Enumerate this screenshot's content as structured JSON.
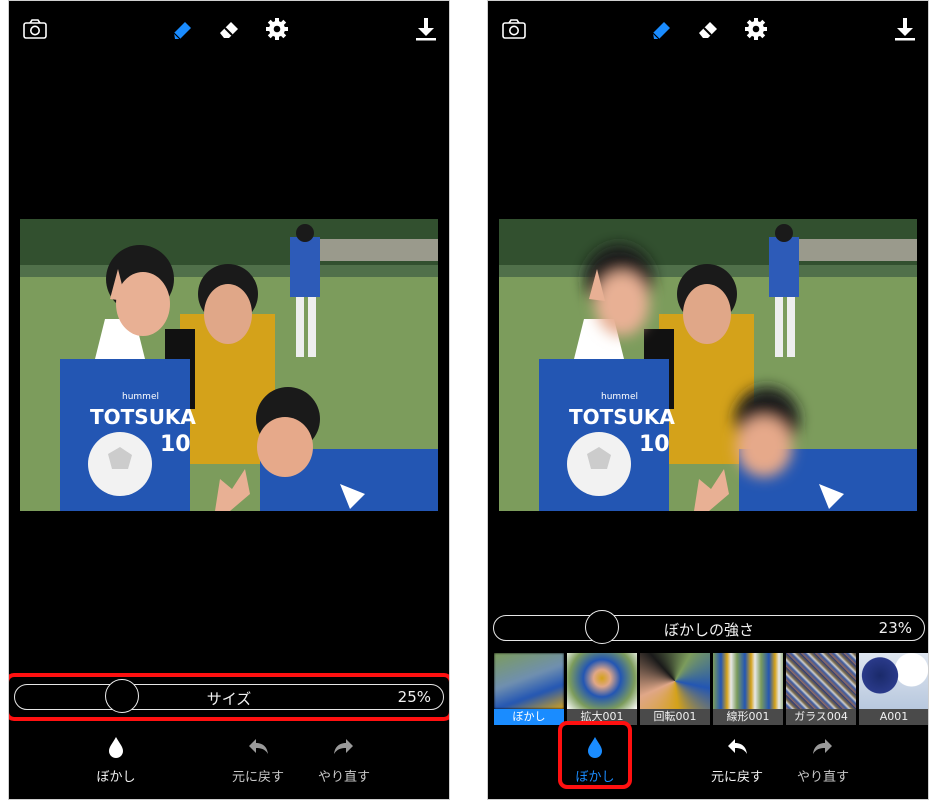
{
  "left_screen": {
    "slider": {
      "label": "サイズ",
      "value": "25%",
      "level": 0.25
    },
    "bottom_bar": {
      "blur": "ぼかし",
      "undo": "元に戻す",
      "redo": "やり直す"
    }
  },
  "right_screen": {
    "slider": {
      "label": "ぼかしの強さ",
      "value": "23%",
      "level": 0.23
    },
    "filters": [
      {
        "label": "ぼかし",
        "selected": true
      },
      {
        "label": "拡大001",
        "selected": false
      },
      {
        "label": "回転001",
        "selected": false
      },
      {
        "label": "線形001",
        "selected": false
      },
      {
        "label": "ガラス004",
        "selected": false
      },
      {
        "label": "A001",
        "selected": false
      }
    ],
    "bottom_bar": {
      "blur": "ぼかし",
      "undo": "元に戻す",
      "redo": "やり直す"
    }
  },
  "photo": {
    "shirt_text": "TOTSUKA",
    "number": "10",
    "brand": "hummel"
  },
  "icons": {
    "camera": "camera-icon",
    "brush": "eraser-brush-icon",
    "eraser": "eraser-icon",
    "settings": "gear-icon",
    "save": "download-icon",
    "blur": "drop-icon",
    "undo": "undo-arrow-icon",
    "redo": "redo-arrow-icon"
  },
  "colors": {
    "accent": "#1a8cff",
    "highlight": "#ff1010",
    "background": "#000000"
  }
}
